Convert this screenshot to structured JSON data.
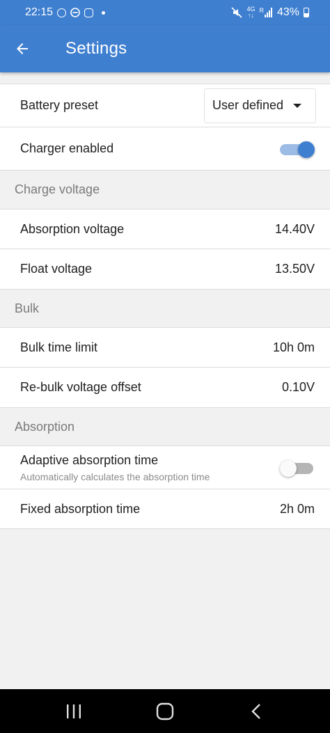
{
  "status_bar": {
    "time": "22:15",
    "network_top": "4G",
    "network_sub": "↑↓",
    "roaming": "R",
    "battery": "43%"
  },
  "app_bar": {
    "title": "Settings"
  },
  "settings": {
    "battery_preset": {
      "label": "Battery preset",
      "value": "User defined"
    },
    "charger_enabled": {
      "label": "Charger enabled",
      "on": true
    },
    "section_charge_voltage": "Charge voltage",
    "absorption_voltage": {
      "label": "Absorption voltage",
      "value": "14.40V"
    },
    "float_voltage": {
      "label": "Float voltage",
      "value": "13.50V"
    },
    "section_bulk": "Bulk",
    "bulk_time_limit": {
      "label": "Bulk time limit",
      "value": "10h 0m"
    },
    "rebulk_voltage_offset": {
      "label": "Re-bulk voltage offset",
      "value": "0.10V"
    },
    "section_absorption": "Absorption",
    "adaptive_absorption": {
      "label": "Adaptive absorption time",
      "description": "Automatically calculates the absorption time",
      "on": false
    },
    "fixed_absorption_time": {
      "label": "Fixed absorption time",
      "value": "2h 0m"
    }
  },
  "colors": {
    "primary": "#3f7fd0",
    "toggle_track_on": "#9cbce6",
    "background": "#f1f1f1",
    "section_text": "#7a7a7a"
  },
  "icons": {
    "back": "arrow-left-icon",
    "whatsapp": "whatsapp-icon",
    "dnd": "do-not-disturb-icon",
    "instagram": "instagram-icon",
    "mute": "mute-icon",
    "signal": "signal-icon",
    "battery": "battery-icon",
    "recents": "recents-icon",
    "home": "home-icon",
    "nav_back": "chevron-left-icon"
  }
}
